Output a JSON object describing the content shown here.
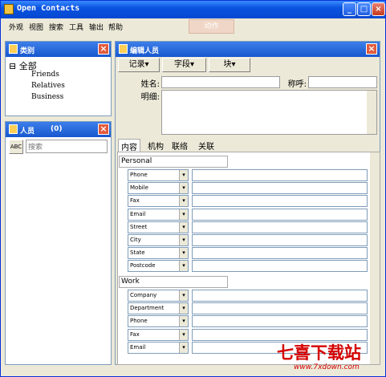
{
  "window": {
    "title": "Open Contacts"
  },
  "menu": [
    "外观",
    "视图",
    "搜索",
    "工具",
    "输出",
    "帮助"
  ],
  "action_button": "动作",
  "category_panel": {
    "title": "类别",
    "root": "全部",
    "items": [
      "Friends",
      "Relatives",
      "Business"
    ]
  },
  "people_panel": {
    "title": "人员",
    "count": "(0)",
    "search_placeholder": "搜索"
  },
  "edit_panel": {
    "title": "编辑人员",
    "toolbar": [
      "记录▾",
      "字段▾",
      "块▾"
    ],
    "name_label": "姓名:",
    "title_label": "称呼:",
    "detail_label": "明细:",
    "tabs": [
      "内容",
      "机构",
      "联络",
      "关联"
    ],
    "personal": {
      "header": "Personal",
      "fields": [
        "Phone",
        "Mobile",
        "Fax",
        "Email",
        "Street",
        "City",
        "State",
        "Postcode"
      ]
    },
    "work": {
      "header": "Work",
      "fields": [
        "Company",
        "Department",
        "Phone",
        "Fax",
        "Email"
      ]
    }
  },
  "watermark": {
    "main": "七喜下载站",
    "url": "www.7xdown.com"
  }
}
